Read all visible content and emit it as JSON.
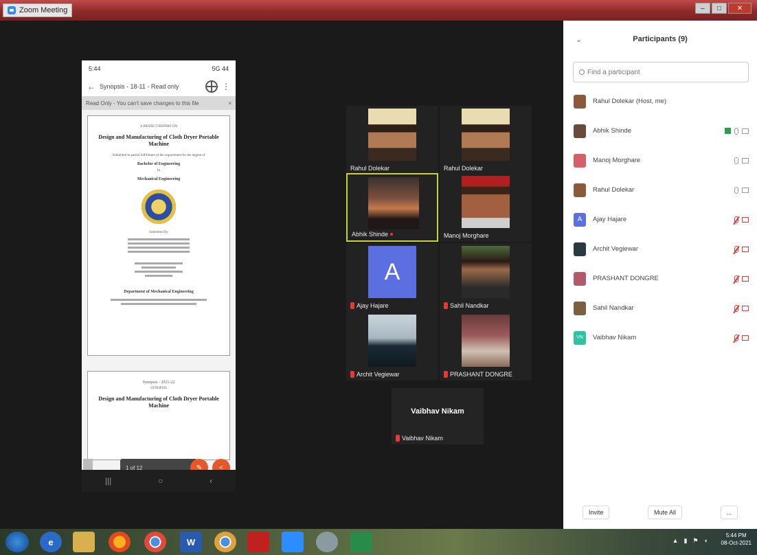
{
  "window": {
    "title": "Zoom Meeting",
    "controls": [
      "–",
      "□",
      "✕"
    ]
  },
  "phone": {
    "status_time": "5:44",
    "status_right": "5G 44",
    "path": "Synopsis - 18-11 - Read only",
    "banner": "Read Only - You can't save changes to this file",
    "page1": {
      "top_small": "A PROJECT REPORT ON",
      "title": "Design and Manufacturing of Cloth Dryer Portable Machine",
      "sub": "Submitted in partial fulfillment of the requirement for the degree of",
      "degree": "Bachelor of Engineering",
      "in": "In",
      "dept": "Mechanical Engineering",
      "submitted_by": "Submitted By",
      "bottom_heading": "Department of Mechanical Engineering"
    },
    "page2": {
      "top": "Synopsis - 2021-22",
      "sub": "SYNOPSIS",
      "title": "Design and Manufacturing of Cloth Dryer Portable Machine"
    },
    "pager": "1 of 12",
    "nav_glyphs": [
      "|||",
      "○",
      "‹"
    ]
  },
  "gallery": {
    "tiles": [
      {
        "name": "Rahul Dolekar"
      },
      {
        "name": "Rahul Dolekar"
      },
      {
        "name": "Abhik Shinde"
      },
      {
        "name": "Manoj Morghare"
      },
      {
        "name": "Ajay Hajare",
        "letter": "A"
      },
      {
        "name": "Sahil Nandkar"
      },
      {
        "name": "Archit Vegiewar"
      },
      {
        "name": "PRASHANT DONGRE"
      }
    ],
    "extra_tile": {
      "big_name": "Vaibhav Nikam",
      "name": "Vaibhav Nikam"
    }
  },
  "participants": {
    "title": "Participants (9)",
    "collapse_glyph": "⌄",
    "search_placeholder": "Find a participant",
    "list": [
      {
        "name": "Rahul Dolekar (Host, me)",
        "color": "#8a5a3a"
      },
      {
        "name": "Abhik Shinde",
        "color": "#6a4a3a"
      },
      {
        "name": "Manoj Morghare",
        "color": "#d4606a"
      },
      {
        "name": "Rahul Dolekar",
        "color": "#8a5a3a"
      },
      {
        "name": "Ajay Hajare",
        "color": "#5b6fe0",
        "letter": "A"
      },
      {
        "name": "Archit Vegiewar",
        "color": "#2a3a40"
      },
      {
        "name": "PRASHANT DONGRE",
        "color": "#b05a6a"
      },
      {
        "name": "Sahil Nandkar",
        "color": "#7a6040"
      },
      {
        "name": "Vaibhav Nikam",
        "color": "#2ec4a0",
        "letter": "VN"
      }
    ],
    "footer": {
      "invite": "Invite",
      "mute_all": "Mute All",
      "more": "..."
    }
  },
  "taskbar": {
    "clock_time": "5:44 PM",
    "clock_date": "08-Oct-2021",
    "word_label": "W"
  }
}
